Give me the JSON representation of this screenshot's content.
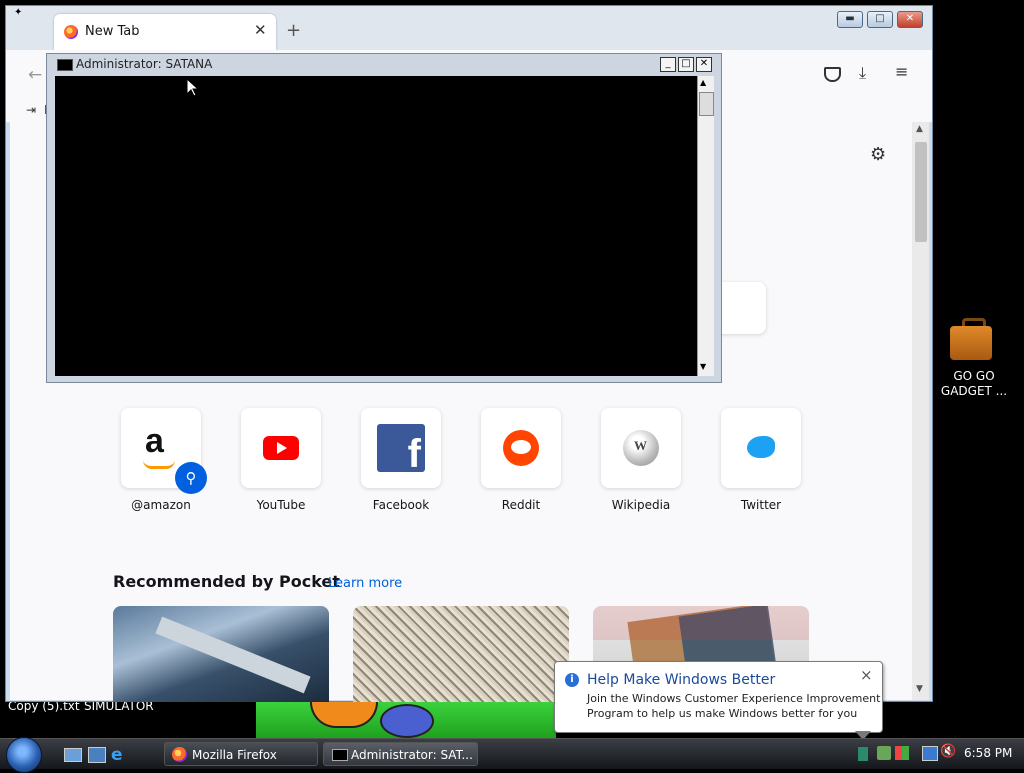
{
  "browser": {
    "tab_title": "New Tab",
    "new_tab_glyph": "+",
    "tab_close_glyph": "✕",
    "nav_back_glyph": "←",
    "bookmark_fragment": "I",
    "toolbar_icons": [
      "pocket-icon",
      "download-icon",
      "menu-icon"
    ],
    "settings_icon": "gear-icon",
    "shortcuts": [
      {
        "label": "@amazon",
        "icon": "amazon-icon"
      },
      {
        "label": "YouTube",
        "icon": "youtube-icon"
      },
      {
        "label": "Facebook",
        "icon": "facebook-icon"
      },
      {
        "label": "Reddit",
        "icon": "reddit-icon"
      },
      {
        "label": "Wikipedia",
        "icon": "wikipedia-icon"
      },
      {
        "label": "Twitter",
        "icon": "twitter-icon"
      }
    ],
    "pocket": {
      "heading": "Recommended by Pocket",
      "learn_more": "Learn more"
    }
  },
  "cmd": {
    "title": "Administrator:  SATANA",
    "icon": "cmd-icon"
  },
  "desktop": {
    "gadget_label": "GO GO GADGET ...",
    "icon_left_label": "Copy (5).txt",
    "icon_right_label": "SIMULATOR"
  },
  "taskbar": {
    "firefox_label": "Mozilla Firefox",
    "cmd_label": "Administrator:  SAT...",
    "clock": "6:58 PM"
  },
  "balloon": {
    "title": "Help Make Windows Better",
    "body_line1": "Join the Windows Customer Experience Improvement",
    "body_line2": "Program to help us make Windows better for you",
    "close_glyph": "×"
  },
  "colors": {
    "accent": "#0060df",
    "youtube": "#ff0000",
    "facebook": "#3b5998",
    "reddit": "#ff4500",
    "twitter": "#1da1f2"
  }
}
